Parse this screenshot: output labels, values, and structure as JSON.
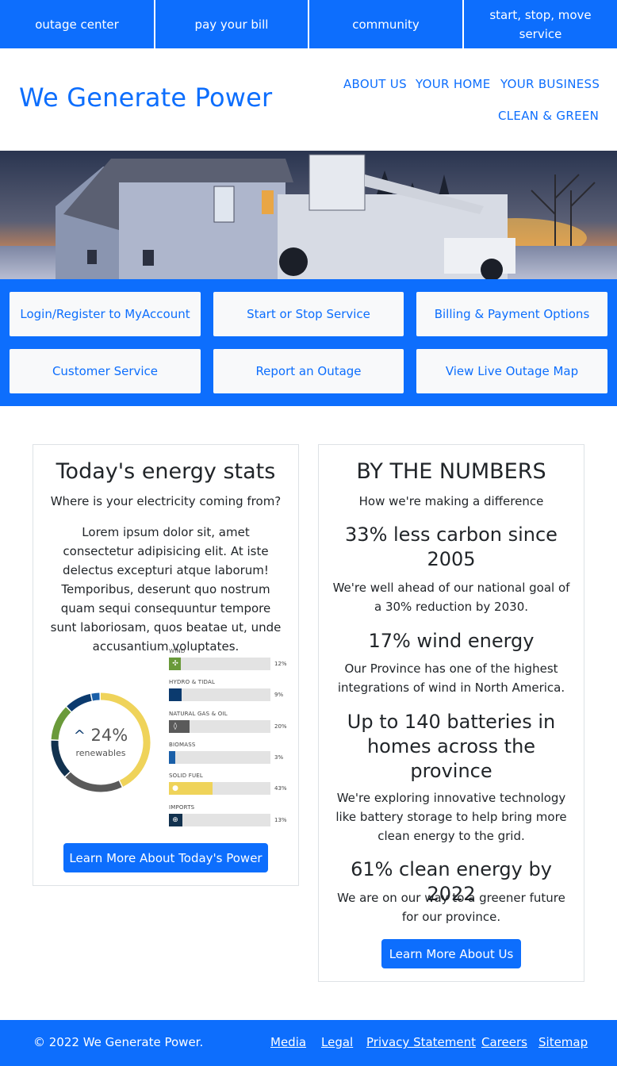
{
  "topbar": {
    "outage": "outage center",
    "bill": "pay your bill",
    "community": "community",
    "service": "start, stop, move service"
  },
  "header": {
    "brand": "We Generate Power",
    "nav": [
      "ABOUT US",
      "YOUR HOME",
      "YOUR BUSINESS",
      "CLEAN & GREEN"
    ]
  },
  "quick_links": [
    "Login/Register to MyAccount",
    "Start or Stop Service",
    "Billing & Payment Options",
    "Customer Service",
    "Report an Outage",
    "View Live Outage Map"
  ],
  "stats": {
    "title": "Today's energy stats",
    "subtitle": "Where is your electricity coming from?",
    "body": "Lorem ipsum dolor sit, amet consectetur adipisicing elit. At iste delectus excepturi atque laborum! Temporibus, deserunt quo nostrum quam sequi consequuntur tempore sunt laboriosam, quos beatae ut, unde accusantium voluptates.",
    "donut_value": "24%",
    "donut_label": "renewables",
    "button": "Learn More About Today's Power",
    "sources": [
      {
        "label": "WIND",
        "pct_text": "12%",
        "value": 12,
        "color": "#6a9a3a",
        "icon": "wind-turbine-icon",
        "glyph": "✣"
      },
      {
        "label": "HYDRO & TIDAL",
        "pct_text": "9%",
        "value": 9,
        "color": "#0b3a6e",
        "icon": "water-icon",
        "glyph": ""
      },
      {
        "label": "NATURAL GAS & OIL",
        "pct_text": "20%",
        "value": 20,
        "color": "#5a5a5a",
        "icon": "flame-icon",
        "glyph": "◊"
      },
      {
        "label": "BIOMASS",
        "pct_text": "3%",
        "value": 3,
        "color": "#1a5fa8",
        "icon": "leaf-icon",
        "glyph": ""
      },
      {
        "label": "SOLID FUEL",
        "pct_text": "43%",
        "value": 43,
        "color": "#efd35a",
        "icon": "coal-icon",
        "glyph": "●"
      },
      {
        "label": "IMPORTS",
        "pct_text": "13%",
        "value": 13,
        "color": "#12324f",
        "icon": "globe-icon",
        "glyph": "⊕"
      }
    ]
  },
  "numbers": {
    "title": "BY THE NUMBERS",
    "subtitle": "How we're making a difference",
    "items": [
      {
        "heading": "33% less carbon since 2005",
        "text": "We're well ahead of our national goal of a 30% reduction by 2030."
      },
      {
        "heading": "17% wind energy",
        "text": "Our Province has one of the highest integrations of wind in North America."
      },
      {
        "heading": "Up to 140 batteries in homes across the province",
        "text": "We're exploring innovative technology like battery storage to help bring more clean energy to the grid."
      },
      {
        "heading": "61% clean energy by 2022",
        "text": "We are on our way to a greener future for our province."
      }
    ],
    "button": "Learn More About Us"
  },
  "footer": {
    "copyright": "© 2022 We Generate Power.",
    "links": [
      "Media",
      "Legal",
      "Privacy Statement",
      "Careers",
      "Sitemap"
    ]
  }
}
